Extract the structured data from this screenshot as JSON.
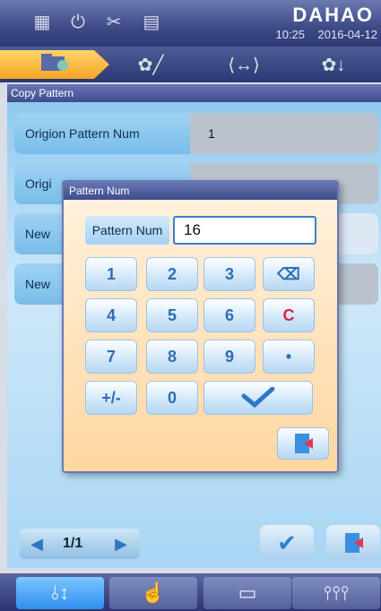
{
  "status": {
    "brand": "DAHAO",
    "time": "10:25",
    "date": "2016-04-12",
    "icons": [
      "network-icon",
      "power-icon",
      "disconnect-icon",
      "channel-1-icon"
    ]
  },
  "modes": [
    {
      "name": "pattern-folder-icon",
      "active": true
    },
    {
      "name": "pattern-edit-icon",
      "active": false
    },
    {
      "name": "frame-move-icon",
      "active": false
    },
    {
      "name": "embroidery-icon",
      "active": false
    }
  ],
  "page": {
    "title": "Copy Pattern",
    "rows": [
      {
        "label": "Origion Pattern Num",
        "value": "1"
      },
      {
        "label": "Origi",
        "value": ""
      },
      {
        "label": "New",
        "value": ""
      },
      {
        "label": "New",
        "value": ""
      }
    ],
    "pager": "1/1"
  },
  "dialog": {
    "title": "Pattern Num",
    "field_label": "Pattern Num",
    "field_value": "16",
    "keys": [
      "1",
      "2",
      "3",
      "4",
      "5",
      "6",
      "7",
      "8",
      "9",
      "•",
      "+/-",
      "0",
      "C"
    ]
  },
  "colors": {
    "accent": "#2f8ef0",
    "delete_key": "#e02045",
    "title_bar": "#3e4b8d"
  }
}
